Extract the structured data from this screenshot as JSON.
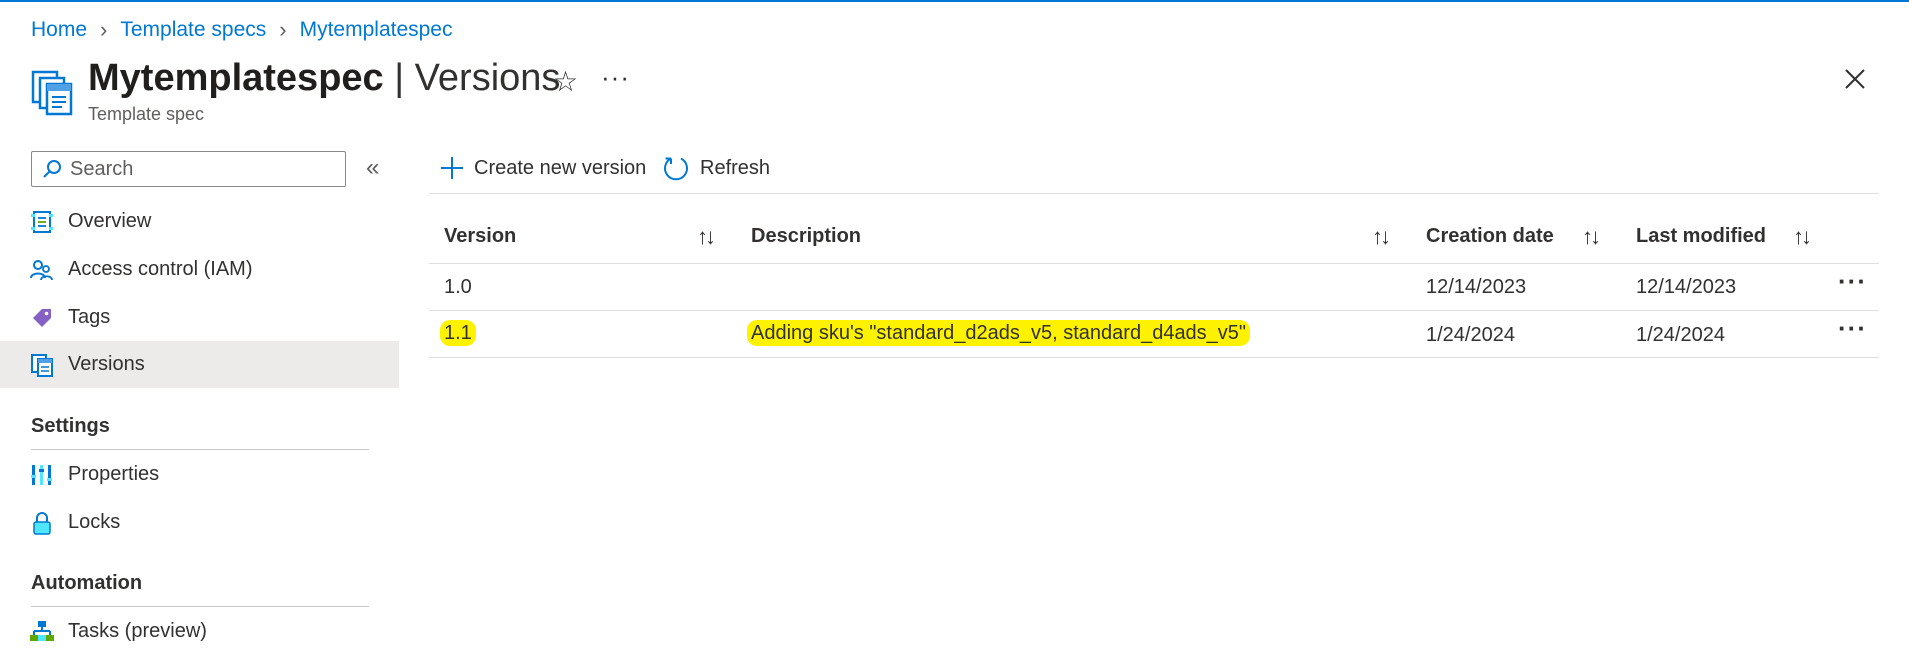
{
  "breadcrumb": {
    "items": [
      "Home",
      "Template specs",
      "Mytemplatespec"
    ]
  },
  "header": {
    "title_main": "Mytemplatespec",
    "title_section": "Versions",
    "subtitle": "Template spec"
  },
  "sidebar": {
    "search_placeholder": "Search",
    "items": [
      {
        "label": "Overview",
        "icon": "overview-icon"
      },
      {
        "label": "Access control (IAM)",
        "icon": "iam-icon"
      },
      {
        "label": "Tags",
        "icon": "tag-icon"
      },
      {
        "label": "Versions",
        "icon": "versions-icon",
        "active": true
      }
    ],
    "sections": [
      {
        "title": "Settings",
        "items": [
          {
            "label": "Properties",
            "icon": "properties-icon"
          },
          {
            "label": "Locks",
            "icon": "lock-icon"
          }
        ]
      },
      {
        "title": "Automation",
        "items": [
          {
            "label": "Tasks (preview)",
            "icon": "tasks-icon"
          }
        ]
      }
    ]
  },
  "toolbar": {
    "create_label": "Create new version",
    "refresh_label": "Refresh"
  },
  "table": {
    "columns": [
      "Version",
      "Description",
      "Creation date",
      "Last modified"
    ],
    "rows": [
      {
        "version": "1.0",
        "description": "",
        "created": "12/14/2023",
        "modified": "12/14/2023",
        "highlighted": false
      },
      {
        "version": "1.1",
        "description": "Adding sku's \"standard_d2ads_v5, standard_d4ads_v5\"",
        "created": "1/24/2024",
        "modified": "1/24/2024",
        "highlighted": true
      }
    ]
  },
  "colors": {
    "accent": "#0078d4",
    "highlight": "#fff200",
    "active_nav": "#edebe9"
  }
}
